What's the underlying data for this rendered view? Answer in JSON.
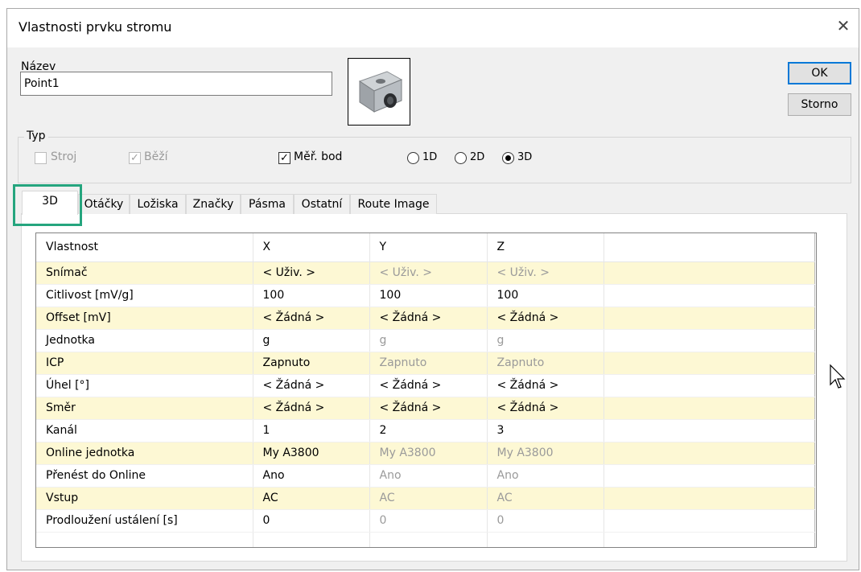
{
  "dialog": {
    "title": "Vlastnosti prvku stromu",
    "close_icon": "close-icon"
  },
  "name": {
    "label": "Název",
    "value": "Point1"
  },
  "buttons": {
    "ok": "OK",
    "cancel": "Storno"
  },
  "type_group": {
    "title": "Typ",
    "machine": {
      "label": "Stroj",
      "checked": false,
      "enabled": false
    },
    "running": {
      "label": "Běží",
      "checked": true,
      "enabled": false
    },
    "meas_point": {
      "label": "Měř. bod",
      "checked": true,
      "enabled": true
    },
    "dims": [
      {
        "label": "1D",
        "selected": false
      },
      {
        "label": "2D",
        "selected": false
      },
      {
        "label": "3D",
        "selected": true
      }
    ]
  },
  "tabs": [
    {
      "label": "3D",
      "active": true
    },
    {
      "label": "Otáčky",
      "active": false
    },
    {
      "label": "Ložiska",
      "active": false
    },
    {
      "label": "Značky",
      "active": false
    },
    {
      "label": "Pásma",
      "active": false
    },
    {
      "label": "Ostatní",
      "active": false
    },
    {
      "label": "Route Image",
      "active": false
    }
  ],
  "grid": {
    "headers": [
      "Vlastnost",
      "X",
      "Y",
      "Z"
    ],
    "rows": [
      {
        "prop": "Snímač",
        "x": "< Uživ. >",
        "y": "< Uživ. >",
        "z": "< Uživ. >",
        "y_gray": true,
        "z_gray": true
      },
      {
        "prop": "Citlivost [mV/g]",
        "x": "100",
        "y": "100",
        "z": "100",
        "y_gray": false,
        "z_gray": false
      },
      {
        "prop": "Offset [mV]",
        "x": "< Žádná >",
        "y": "< Žádná >",
        "z": "< Žádná >",
        "y_gray": false,
        "z_gray": false
      },
      {
        "prop": "Jednotka",
        "x": "g",
        "y": "g",
        "z": "g",
        "y_gray": true,
        "z_gray": true
      },
      {
        "prop": "ICP",
        "x": "Zapnuto",
        "y": "Zapnuto",
        "z": "Zapnuto",
        "y_gray": true,
        "z_gray": true
      },
      {
        "prop": "Úhel [°]",
        "x": "< Žádná >",
        "y": "< Žádná >",
        "z": "< Žádná >",
        "y_gray": false,
        "z_gray": false
      },
      {
        "prop": "Směr",
        "x": "< Žádná >",
        "y": "< Žádná >",
        "z": "< Žádná >",
        "y_gray": false,
        "z_gray": false
      },
      {
        "prop": "Kanál",
        "x": "1",
        "y": "2",
        "z": "3",
        "y_gray": false,
        "z_gray": false
      },
      {
        "prop": "Online jednotka",
        "x": "My A3800",
        "y": "My A3800",
        "z": "My A3800",
        "y_gray": true,
        "z_gray": true
      },
      {
        "prop": "Přenést do Online",
        "x": "Ano",
        "y": "Ano",
        "z": "Ano",
        "y_gray": true,
        "z_gray": true
      },
      {
        "prop": "Vstup",
        "x": "AC",
        "y": "AC",
        "z": "AC",
        "y_gray": true,
        "z_gray": true
      },
      {
        "prop": "Prodloužení ustálení [s]",
        "x": "0",
        "y": "0",
        "z": "0",
        "y_gray": true,
        "z_gray": true
      }
    ]
  },
  "colors": {
    "highlight_row": "#fdf8d4",
    "tab_highlight": "#25a57e",
    "ok_border": "#0078d7"
  }
}
